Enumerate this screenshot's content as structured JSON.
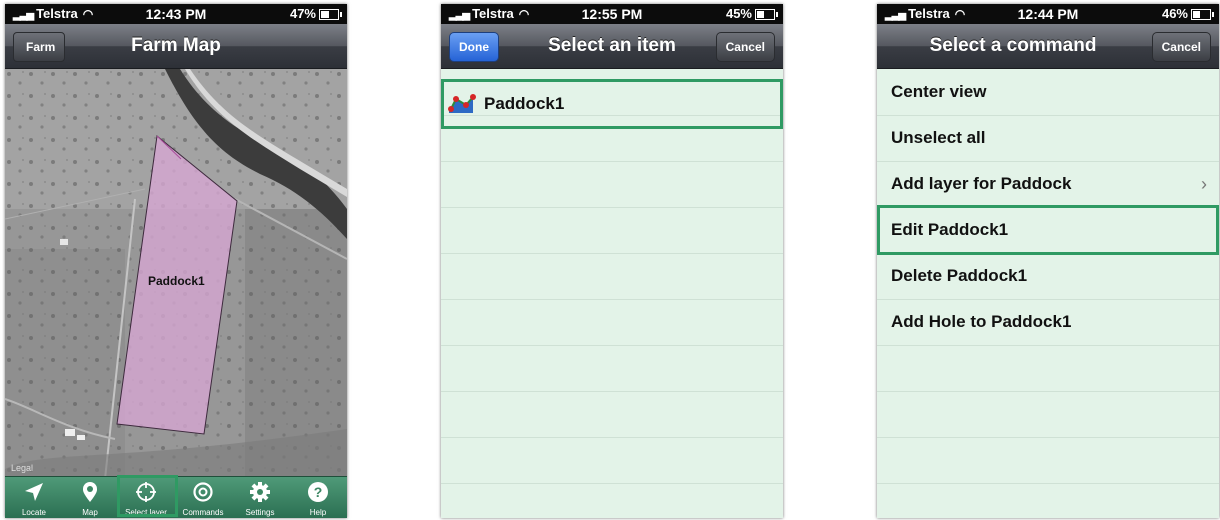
{
  "status_bars": [
    {
      "carrier": "Telstra",
      "time": "12:43 PM",
      "battery": "47%",
      "battery_level": 0.47
    },
    {
      "carrier": "Telstra",
      "time": "12:55 PM",
      "battery": "45%",
      "battery_level": 0.45
    },
    {
      "carrier": "Telstra",
      "time": "12:44 PM",
      "battery": "46%",
      "battery_level": 0.46
    }
  ],
  "screen1": {
    "back_label": "Farm",
    "title": "Farm Map",
    "paddock_label": "Paddock1",
    "legal": "Legal",
    "colors": {
      "paddock_fill": "#d7a6d4",
      "tabbar": "#3c8763",
      "highlight": "#2f9a63"
    },
    "tabs": [
      {
        "label": "Locate",
        "icon": "location-arrow-icon"
      },
      {
        "label": "Map",
        "icon": "map-pin-icon"
      },
      {
        "label": "Select layer",
        "icon": "crosshair-icon",
        "selected": true
      },
      {
        "label": "Commands",
        "icon": "target-icon"
      },
      {
        "label": "Settings",
        "icon": "gear-icon"
      },
      {
        "label": "Help",
        "icon": "help-icon"
      }
    ]
  },
  "screen2": {
    "done_label": "Done",
    "title": "Select an item",
    "cancel_label": "Cancel",
    "items": [
      {
        "label": "Paddock1",
        "icon": "polygon-layer-icon",
        "selected": true
      }
    ]
  },
  "screen3": {
    "title": "Select a command",
    "cancel_label": "Cancel",
    "commands": [
      {
        "label": "Center view"
      },
      {
        "label": "Unselect all"
      },
      {
        "label": "Add layer for Paddock",
        "has_chevron": true
      },
      {
        "label": "Edit Paddock1",
        "selected": true
      },
      {
        "label": "Delete Paddock1"
      },
      {
        "label": "Add Hole to Paddock1"
      }
    ],
    "chevron": "›"
  }
}
